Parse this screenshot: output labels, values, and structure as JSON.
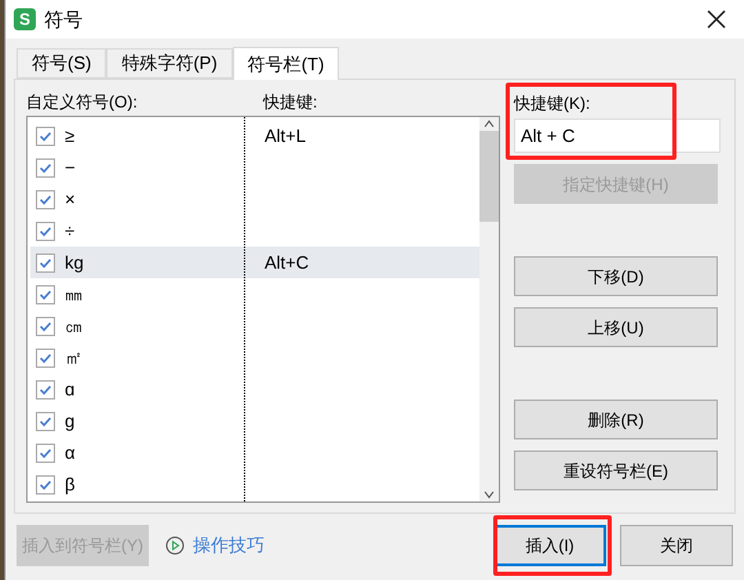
{
  "window": {
    "title": "符号",
    "app_icon": "S"
  },
  "tabs": [
    {
      "label": "符号(S)",
      "selected": false
    },
    {
      "label": "特殊字符(P)",
      "selected": false
    },
    {
      "label": "符号栏(T)",
      "selected": true
    }
  ],
  "list": {
    "symbol_header": "自定义符号(O):",
    "shortcut_header": "快捷键:",
    "rows": [
      {
        "symbol": "≥",
        "checked": true,
        "selected": false,
        "shortcut": "Alt+L"
      },
      {
        "symbol": "−",
        "checked": true,
        "selected": false
      },
      {
        "symbol": "×",
        "checked": true,
        "selected": false
      },
      {
        "symbol": "÷",
        "checked": true,
        "selected": false
      },
      {
        "symbol": "kg",
        "checked": true,
        "selected": true,
        "shortcut": "Alt+C"
      },
      {
        "symbol": "㎜",
        "checked": true,
        "selected": false
      },
      {
        "symbol": "㎝",
        "checked": true,
        "selected": false
      },
      {
        "symbol": "㎡",
        "checked": true,
        "selected": false
      },
      {
        "symbol": "ɑ",
        "checked": true,
        "selected": false
      },
      {
        "symbol": "g",
        "checked": true,
        "selected": false
      },
      {
        "symbol": "α",
        "checked": true,
        "selected": false
      },
      {
        "symbol": "β",
        "checked": true,
        "selected": false
      }
    ]
  },
  "shortcut_field": {
    "label": "快捷键(K):",
    "value": "Alt + C",
    "highlighted": true
  },
  "side_buttons": [
    {
      "label": "指定快捷键(H)",
      "disabled": true,
      "gap_before": false
    },
    {
      "label": "下移(D)",
      "disabled": false,
      "gap_before": true
    },
    {
      "label": "上移(U)",
      "disabled": false,
      "gap_before": false
    },
    {
      "label": "删除(R)",
      "disabled": false,
      "gap_before": true
    },
    {
      "label": "重设符号栏(E)",
      "disabled": false,
      "gap_before": false
    }
  ],
  "footer": {
    "insert_to_bar": {
      "label": "插入到符号栏(Y)",
      "disabled": true
    },
    "tips_link": "操作技巧",
    "buttons": [
      {
        "label": "插入(I)",
        "default": true,
        "highlighted": true
      },
      {
        "label": "关闭",
        "default": false,
        "highlighted": false
      }
    ]
  }
}
